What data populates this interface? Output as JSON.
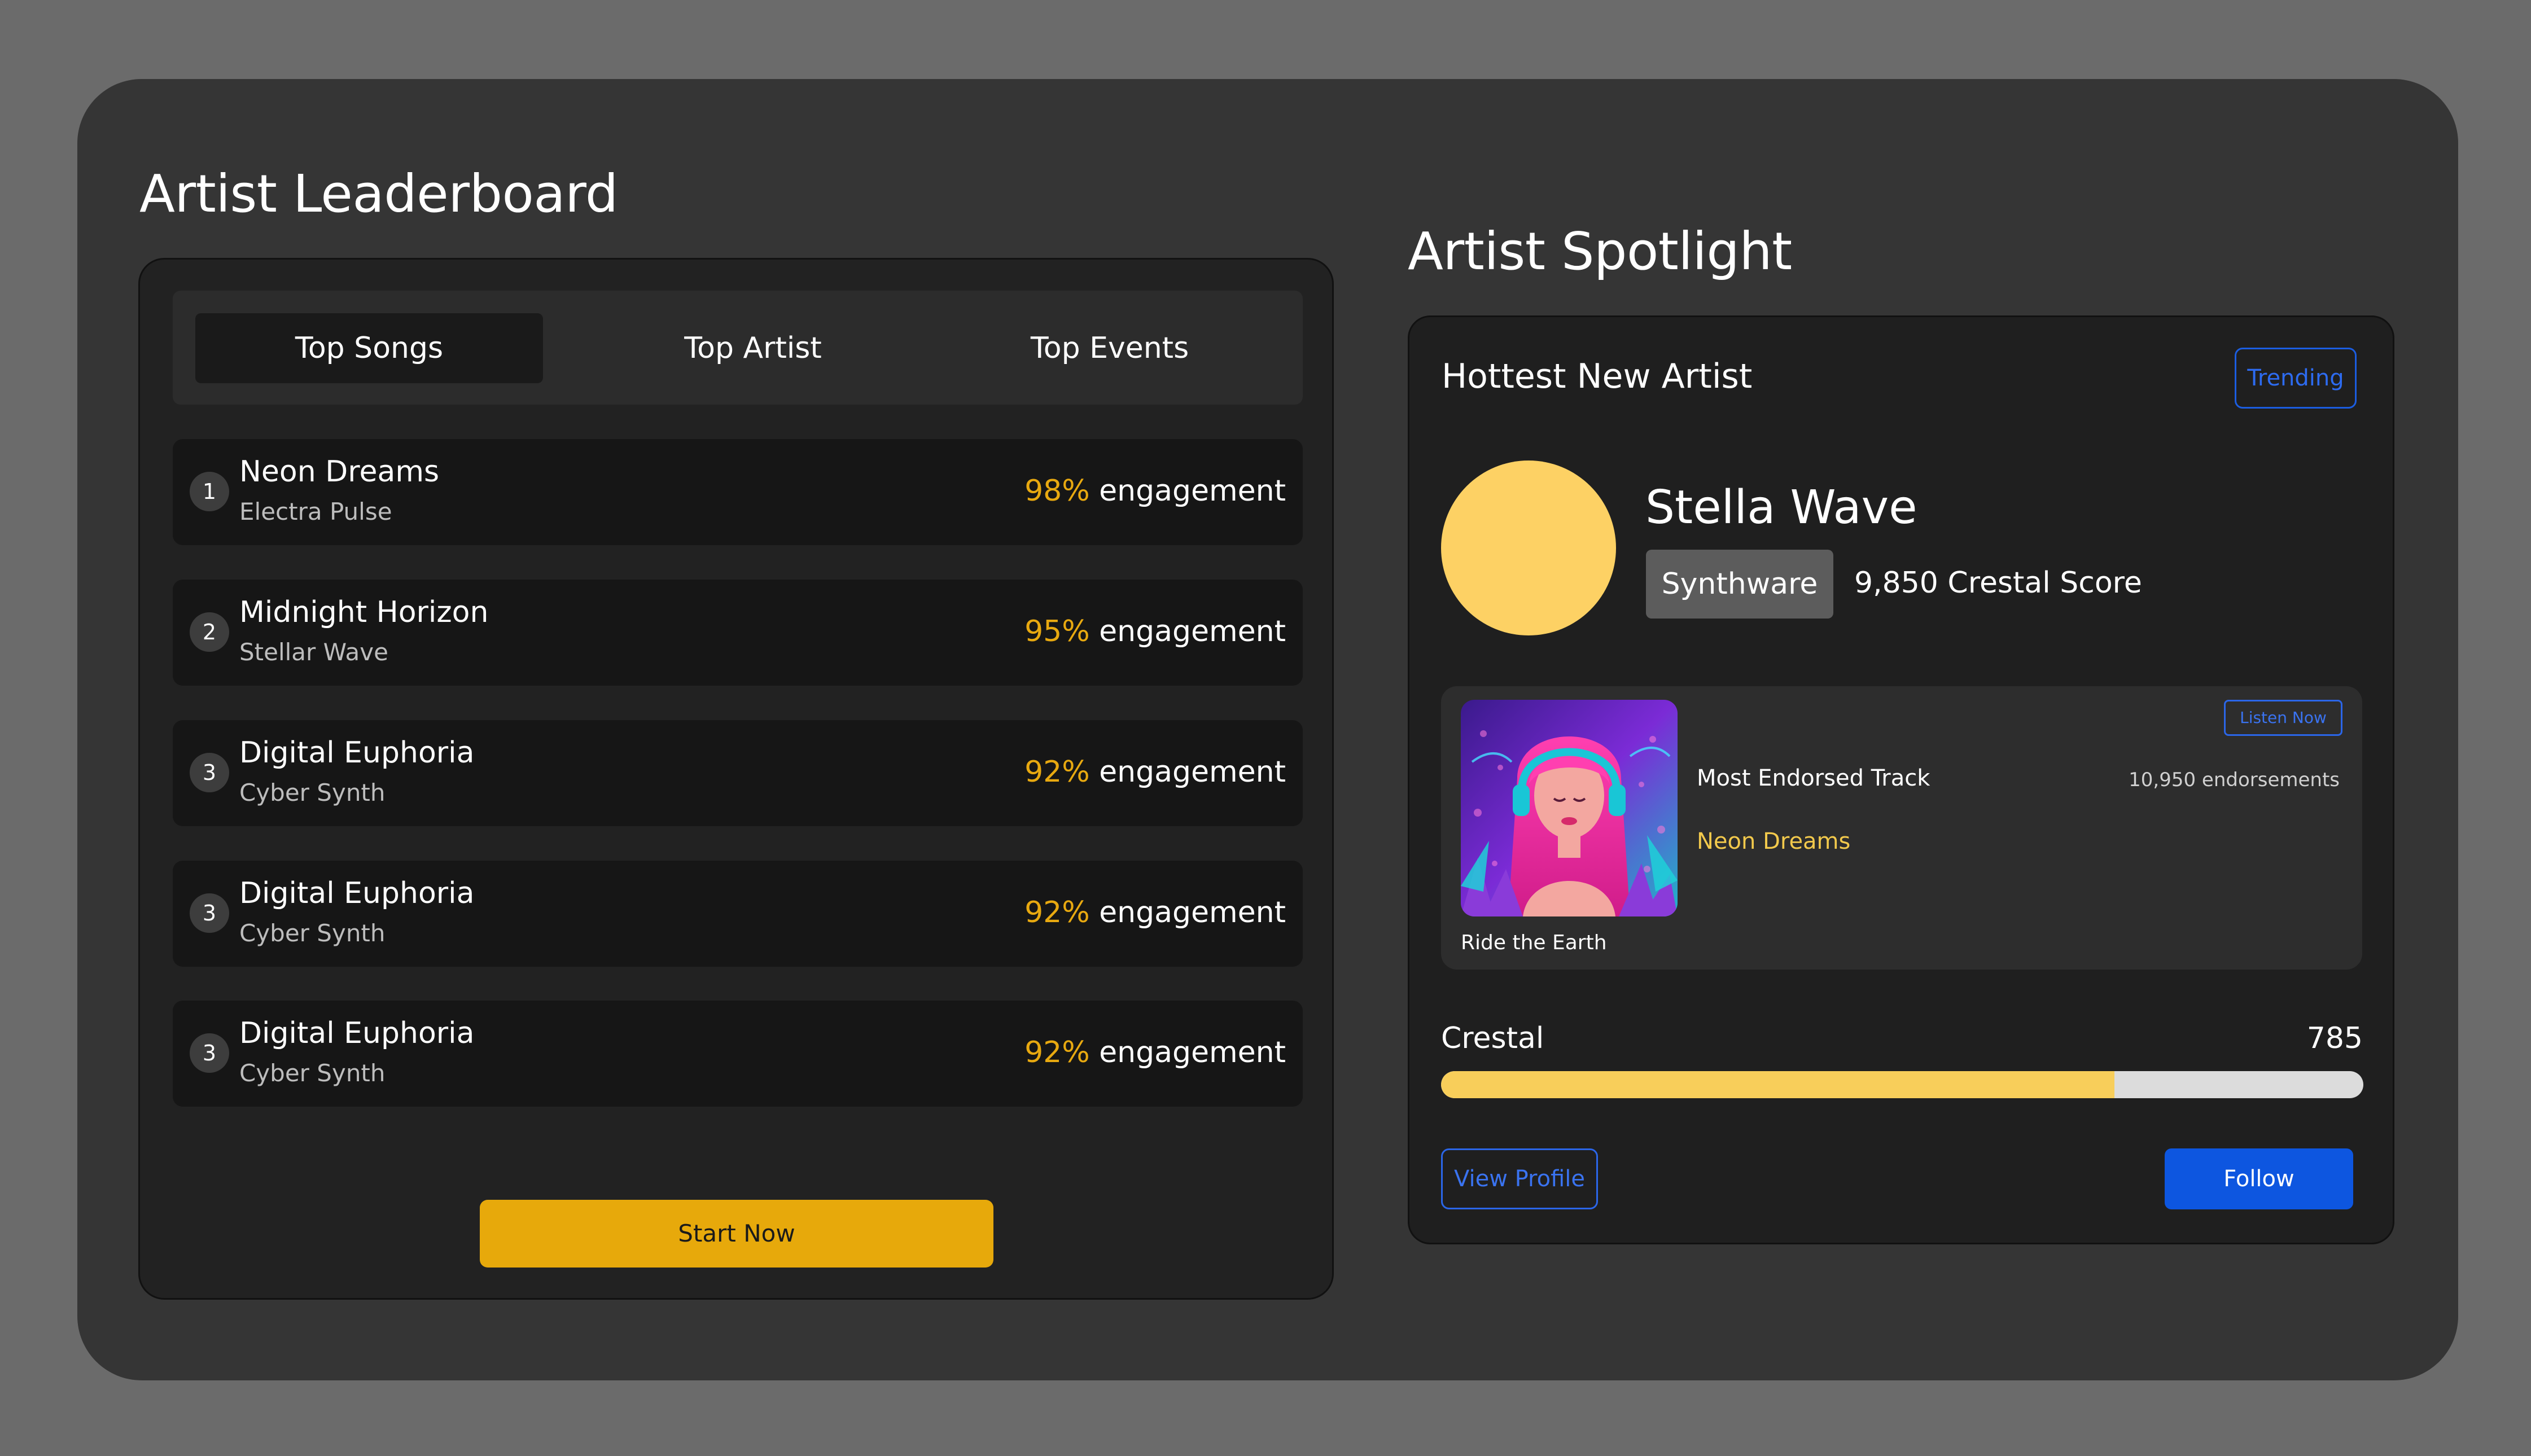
{
  "leaderboard": {
    "title": "Artist Leaderboard",
    "tabs": [
      {
        "label": "Top Songs",
        "active": true
      },
      {
        "label": "Top Artist",
        "active": false
      },
      {
        "label": "Top Events",
        "active": false
      }
    ],
    "rows": [
      {
        "rank": "1",
        "title": "Neon Dreams",
        "artist": "Electra Pulse",
        "pct": "98%",
        "suffix": "engagement"
      },
      {
        "rank": "2",
        "title": "Midnight Horizon",
        "artist": "Stellar Wave",
        "pct": "95%",
        "suffix": "engagement"
      },
      {
        "rank": "3",
        "title": "Digital Euphoria",
        "artist": "Cyber Synth",
        "pct": "92%",
        "suffix": "engagement"
      },
      {
        "rank": "3",
        "title": "Digital Euphoria",
        "artist": "Cyber Synth",
        "pct": "92%",
        "suffix": "engagement"
      },
      {
        "rank": "3",
        "title": "Digital Euphoria",
        "artist": "Cyber Synth",
        "pct": "92%",
        "suffix": "engagement"
      }
    ],
    "start_label": "Start Now"
  },
  "spotlight": {
    "title": "Artist Spotlight",
    "heading": "Hottest New Artist",
    "trending_label": "Trending",
    "artist_name": "Stella Wave",
    "genre": "Synthware",
    "score": "9,850 Crestal Score",
    "track": {
      "label": "Most Endorsed Track",
      "name": "Neon Dreams",
      "endorsements": "10,950 endorsements",
      "listen_label": "Listen Now",
      "caption": "Ride the Earth"
    },
    "progress": {
      "label": "Crestal",
      "value": "785",
      "fraction": 0.73
    },
    "view_profile_label": "View Profile",
    "follow_label": "Follow"
  },
  "colors": {
    "accent_yellow": "#e7a90b",
    "avatar_yellow": "#fdd164",
    "accent_blue": "#0d56e0"
  }
}
